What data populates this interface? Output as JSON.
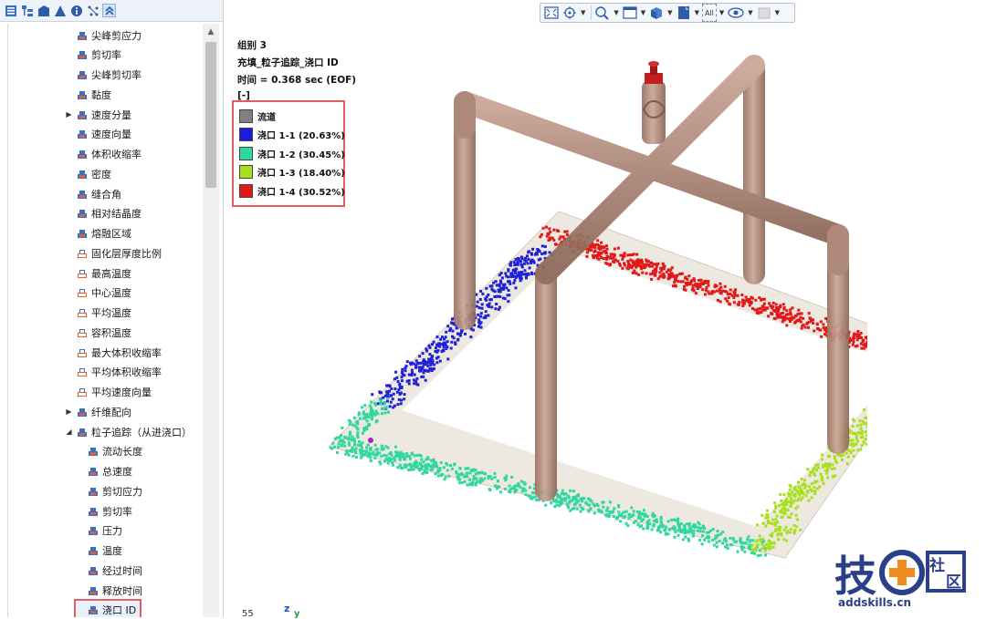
{
  "left_toolbar": {
    "icons": [
      "list-view-icon",
      "tree-view-icon",
      "model-icon",
      "part-icon",
      "info-icon",
      "mesh-icon",
      "collapse-icon"
    ]
  },
  "tree": {
    "items": [
      {
        "label": "尖峰剪应力",
        "indent": 1,
        "icon": "result-blue",
        "arrow": ""
      },
      {
        "label": "剪切率",
        "indent": 1,
        "icon": "result-blue",
        "arrow": ""
      },
      {
        "label": "尖峰剪切率",
        "indent": 1,
        "icon": "result-blue",
        "arrow": ""
      },
      {
        "label": "黏度",
        "indent": 1,
        "icon": "result-blue",
        "arrow": ""
      },
      {
        "label": "速度分量",
        "indent": 1,
        "icon": "result-blue",
        "arrow": "collapsed"
      },
      {
        "label": "速度向量",
        "indent": 1,
        "icon": "result-blue",
        "arrow": ""
      },
      {
        "label": "体积收缩率",
        "indent": 1,
        "icon": "result-blue",
        "arrow": ""
      },
      {
        "label": "密度",
        "indent": 1,
        "icon": "result-blue",
        "arrow": ""
      },
      {
        "label": "缝合角",
        "indent": 1,
        "icon": "result-blue",
        "arrow": ""
      },
      {
        "label": "相对结晶度",
        "indent": 1,
        "icon": "result-blue",
        "arrow": ""
      },
      {
        "label": "熔融区域",
        "indent": 1,
        "icon": "result-blue",
        "arrow": ""
      },
      {
        "label": "固化层厚度比例",
        "indent": 1,
        "icon": "result-outline",
        "arrow": ""
      },
      {
        "label": "最高温度",
        "indent": 1,
        "icon": "result-outline",
        "arrow": ""
      },
      {
        "label": "中心温度",
        "indent": 1,
        "icon": "result-outline",
        "arrow": ""
      },
      {
        "label": "平均温度",
        "indent": 1,
        "icon": "result-outline",
        "arrow": ""
      },
      {
        "label": "容积温度",
        "indent": 1,
        "icon": "result-outline",
        "arrow": ""
      },
      {
        "label": "最大体积收缩率",
        "indent": 1,
        "icon": "result-outline",
        "arrow": ""
      },
      {
        "label": "平均体积收缩率",
        "indent": 1,
        "icon": "result-outline",
        "arrow": ""
      },
      {
        "label": "平均速度向量",
        "indent": 1,
        "icon": "result-outline",
        "arrow": ""
      },
      {
        "label": "纤维配向",
        "indent": 1,
        "icon": "result-blue",
        "arrow": "collapsed"
      },
      {
        "label": "粒子追踪（从进浇口）",
        "indent": 1,
        "icon": "result-blue",
        "arrow": "expanded"
      },
      {
        "label": "流动长度",
        "indent": 2,
        "icon": "result-blue",
        "arrow": ""
      },
      {
        "label": "总速度",
        "indent": 2,
        "icon": "result-blue",
        "arrow": ""
      },
      {
        "label": "剪切应力",
        "indent": 2,
        "icon": "result-blue",
        "arrow": ""
      },
      {
        "label": "剪切率",
        "indent": 2,
        "icon": "result-blue",
        "arrow": ""
      },
      {
        "label": "压力",
        "indent": 2,
        "icon": "result-blue",
        "arrow": ""
      },
      {
        "label": "温度",
        "indent": 2,
        "icon": "result-blue",
        "arrow": ""
      },
      {
        "label": "经过时间",
        "indent": 2,
        "icon": "result-blue",
        "arrow": ""
      },
      {
        "label": "释放时间",
        "indent": 2,
        "icon": "result-blue",
        "arrow": ""
      },
      {
        "label": "浇口 ID",
        "indent": 2,
        "icon": "result-blue",
        "arrow": "",
        "selected": true
      }
    ]
  },
  "view_toolbar": {
    "display_filter": "All",
    "buttons": [
      "fit-view-icon",
      "rotate-center-icon",
      "zoom-icon",
      "window-icon",
      "cube-view-icon",
      "page-icon",
      "all-filter",
      "eye-icon",
      "shading-icon"
    ]
  },
  "info": {
    "group": "组别 3",
    "result": "充填_粒子追踪_浇口 ID",
    "time": "时间 = 0.368 sec (EOF)",
    "unit": "[-]"
  },
  "legend": {
    "items": [
      {
        "label": "流道",
        "color": "#808080"
      },
      {
        "label": "浇口 1-1 (20.63%)",
        "color": "#1a1ae0"
      },
      {
        "label": "浇口 1-2 (30.45%)",
        "color": "#2ed8a0"
      },
      {
        "label": "浇口 1-3 (18.40%)",
        "color": "#a8e020"
      },
      {
        "label": "浇口 1-4 (30.52%)",
        "color": "#e01818"
      }
    ]
  },
  "axis": {
    "scale": "55",
    "z": "z",
    "y": "y"
  },
  "watermark": {
    "url": "addskills.cn",
    "logo_text": "技",
    "badge_text": "社区"
  },
  "colors": {
    "runner": "#b08878",
    "blue": "#2020d8",
    "cyan": "#2ed8a0",
    "lime": "#a8e020",
    "red": "#e01818",
    "plate": "#ede8e0"
  }
}
